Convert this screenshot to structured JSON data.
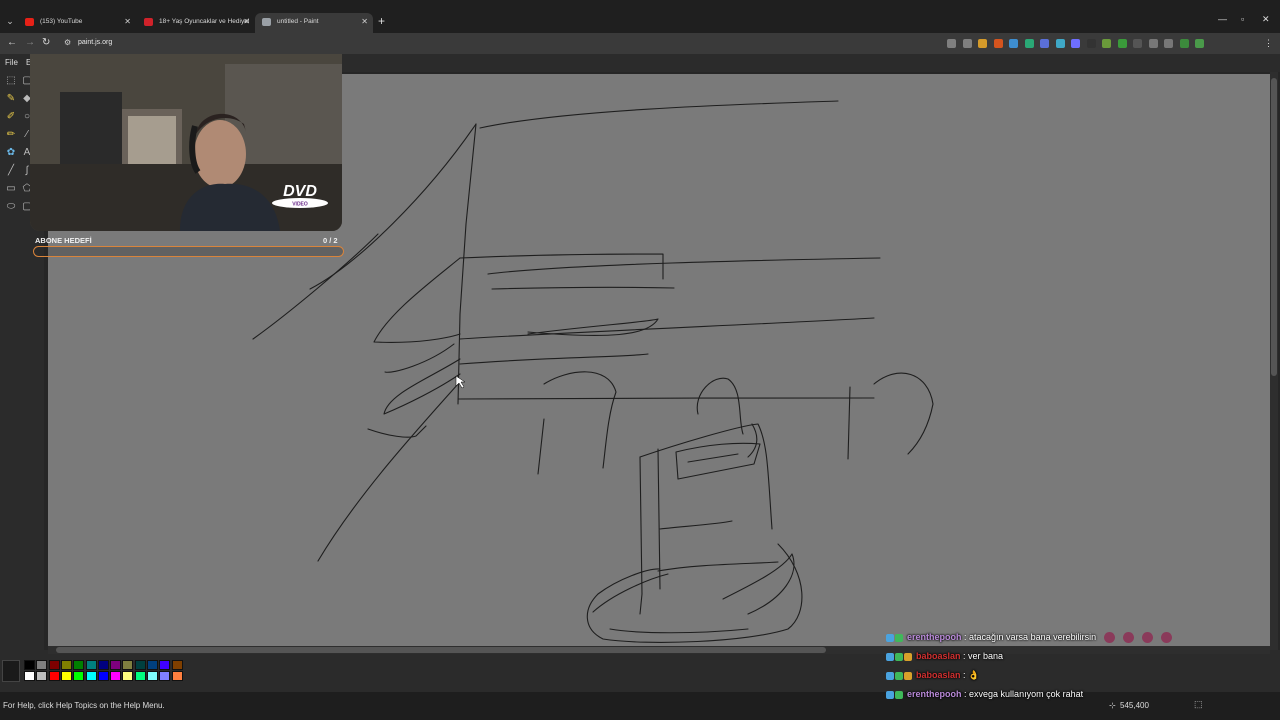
{
  "browser": {
    "tabs": [
      {
        "title": "(153) YouTube",
        "fav_color": "#e62117"
      },
      {
        "title": "18+ Yaş Oyuncaklar ve Hediyel",
        "fav_color": "#d0222a"
      },
      {
        "title": "untitled - Paint",
        "fav_color": "#9aa0a6"
      }
    ],
    "url": "paint.js.org",
    "extension_colors": [
      "#7f7f7f",
      "#7f7f7f",
      "#d49a2a",
      "#d4541e",
      "#3e8ed0",
      "#2aa876",
      "#5a6fd8",
      "#3fa8c7",
      "#6e6eff",
      "#333333",
      "#6a9a3a",
      "#3a9a3a",
      "#555555",
      "#777777",
      "#777777",
      "#3c8a3c",
      "#4a9a4a"
    ]
  },
  "paint": {
    "menu_file": "File",
    "menu_second": "E",
    "status_help": "For Help, click Help Topics on the Help Menu.",
    "cursor_coords": "545,400",
    "palette_colors": [
      "#000000",
      "#7f7f7f",
      "#7f0000",
      "#7f7f00",
      "#007f00",
      "#007f7f",
      "#00007f",
      "#7f007f",
      "#7f7f3f",
      "#003f3f",
      "#003f7f",
      "#3f00ff",
      "#7f3f00",
      "#ffffff",
      "#bfbfbf",
      "#ff0000",
      "#ffff00",
      "#00ff00",
      "#00ffff",
      "#0000ff",
      "#ff00ff",
      "#ffff7f",
      "#00ff7f",
      "#7fffff",
      "#7f7fff",
      "#ff7f3f"
    ]
  },
  "stream": {
    "goal_label": "ABONE HEDEFİ",
    "goal_count": "0",
    "goal_total": "/ 2",
    "goal_progress": 0,
    "goal_color": "#d9843b",
    "dvd_text": "DVD",
    "dvd_sub": "VIDEO",
    "chat": [
      {
        "user": "erenthepooh",
        "user_color": "#b98ad9",
        "message": "atacağın varsa bana verebilirsin"
      },
      {
        "user": "baboaslan",
        "user_color": "#d03030",
        "message": "ver bana"
      },
      {
        "user": "baboaslan",
        "user_color": "#d03030",
        "message": "👌"
      },
      {
        "user": "erenthepooh",
        "user_color": "#b98ad9",
        "message": "exvega kullanıyom çok rahat"
      }
    ]
  }
}
